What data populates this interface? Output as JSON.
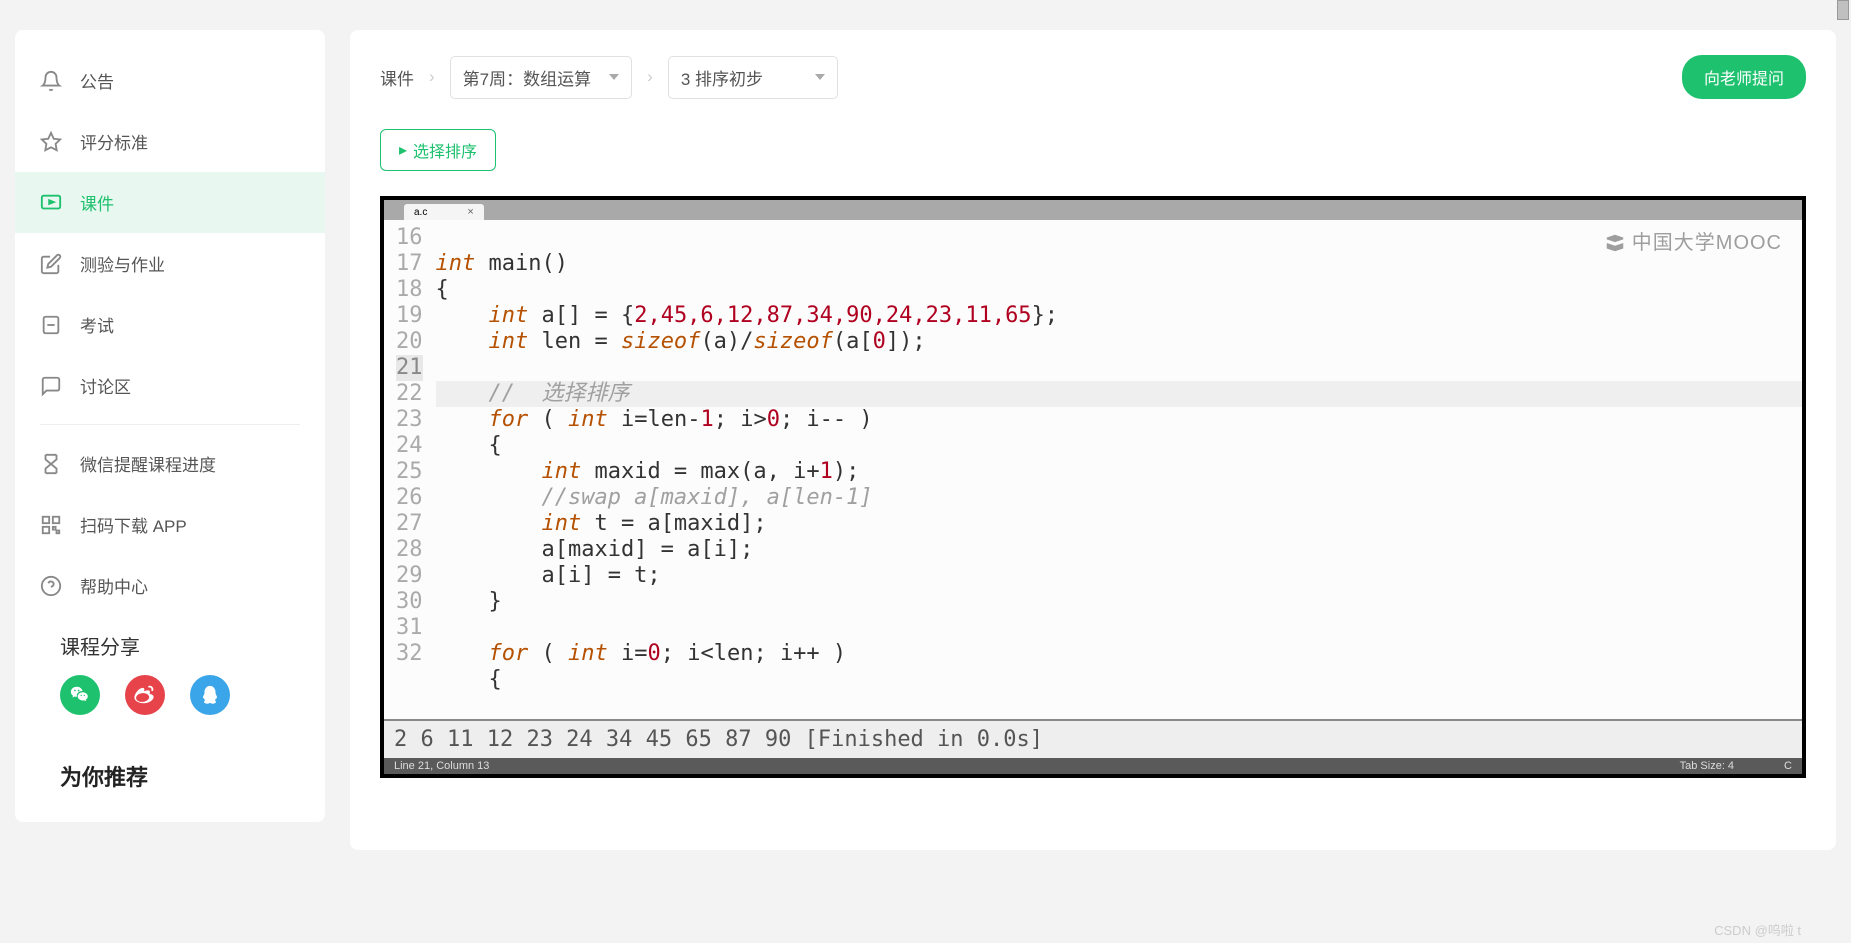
{
  "sidebar": {
    "items": [
      {
        "label": "公告",
        "icon": "bell"
      },
      {
        "label": "评分标准",
        "icon": "star"
      },
      {
        "label": "课件",
        "icon": "screen"
      },
      {
        "label": "测验与作业",
        "icon": "edit"
      },
      {
        "label": "考试",
        "icon": "doc"
      },
      {
        "label": "讨论区",
        "icon": "chat"
      },
      {
        "label": "微信提醒课程进度",
        "icon": "hourglass"
      },
      {
        "label": "扫码下载 APP",
        "icon": "qr"
      },
      {
        "label": "帮助中心",
        "icon": "help"
      }
    ],
    "share_title": "课程分享",
    "recommend_title": "为你推荐"
  },
  "breadcrumb": {
    "root": "课件",
    "week": "第7周：数组运算",
    "lesson": "3 排序初步"
  },
  "buttons": {
    "ask": "向老师提问",
    "action": "选择排序"
  },
  "editor": {
    "tab_name": "a.c",
    "watermark": "中国大学MOOC",
    "lines": {
      "start": 16,
      "end": 32,
      "highlight": 21,
      "l16a": "int",
      "l16b": " main()",
      "l17": "{",
      "l18a": "int",
      "l18b": " a[] = {",
      "l18c": "2,45,6,12,87,34,90,24,23,11,65",
      "l18d": "};",
      "l19a": "int",
      "l19b": " len = ",
      "l19c": "sizeof",
      "l19d": "(a)/",
      "l19e": "sizeof",
      "l19f": "(a[",
      "l19g": "0",
      "l19h": "]);",
      "l21": "//  选择排序",
      "l22a": "for",
      "l22b": " ( ",
      "l22c": "int",
      "l22d": " i=len-",
      "l22e": "1",
      "l22f": "; i>",
      "l22g": "0",
      "l22h": "; i-- )",
      "l23": "{",
      "l24a": "int",
      "l24b": " maxid = max(a, i+",
      "l24c": "1",
      "l24d": ");",
      "l25": "//swap a[maxid], a[len-1]",
      "l26a": "int",
      "l26b": " t = a[maxid];",
      "l27": "a[maxid] = a[i];",
      "l28": "a[i] = t;",
      "l29": "}",
      "l31a": "for",
      "l31b": " ( ",
      "l31c": "int",
      "l31d": " i=",
      "l31e": "0",
      "l31f": "; i<len; i++ )",
      "l32": "{"
    },
    "output": "2 6 11 12 23 24 34 45 65 87 90  [Finished in 0.0s]",
    "status_left": "Line 21, Column 13",
    "status_tab": "Tab Size: 4",
    "status_lang": "C"
  },
  "csdn": "CSDN @呜啦 t"
}
